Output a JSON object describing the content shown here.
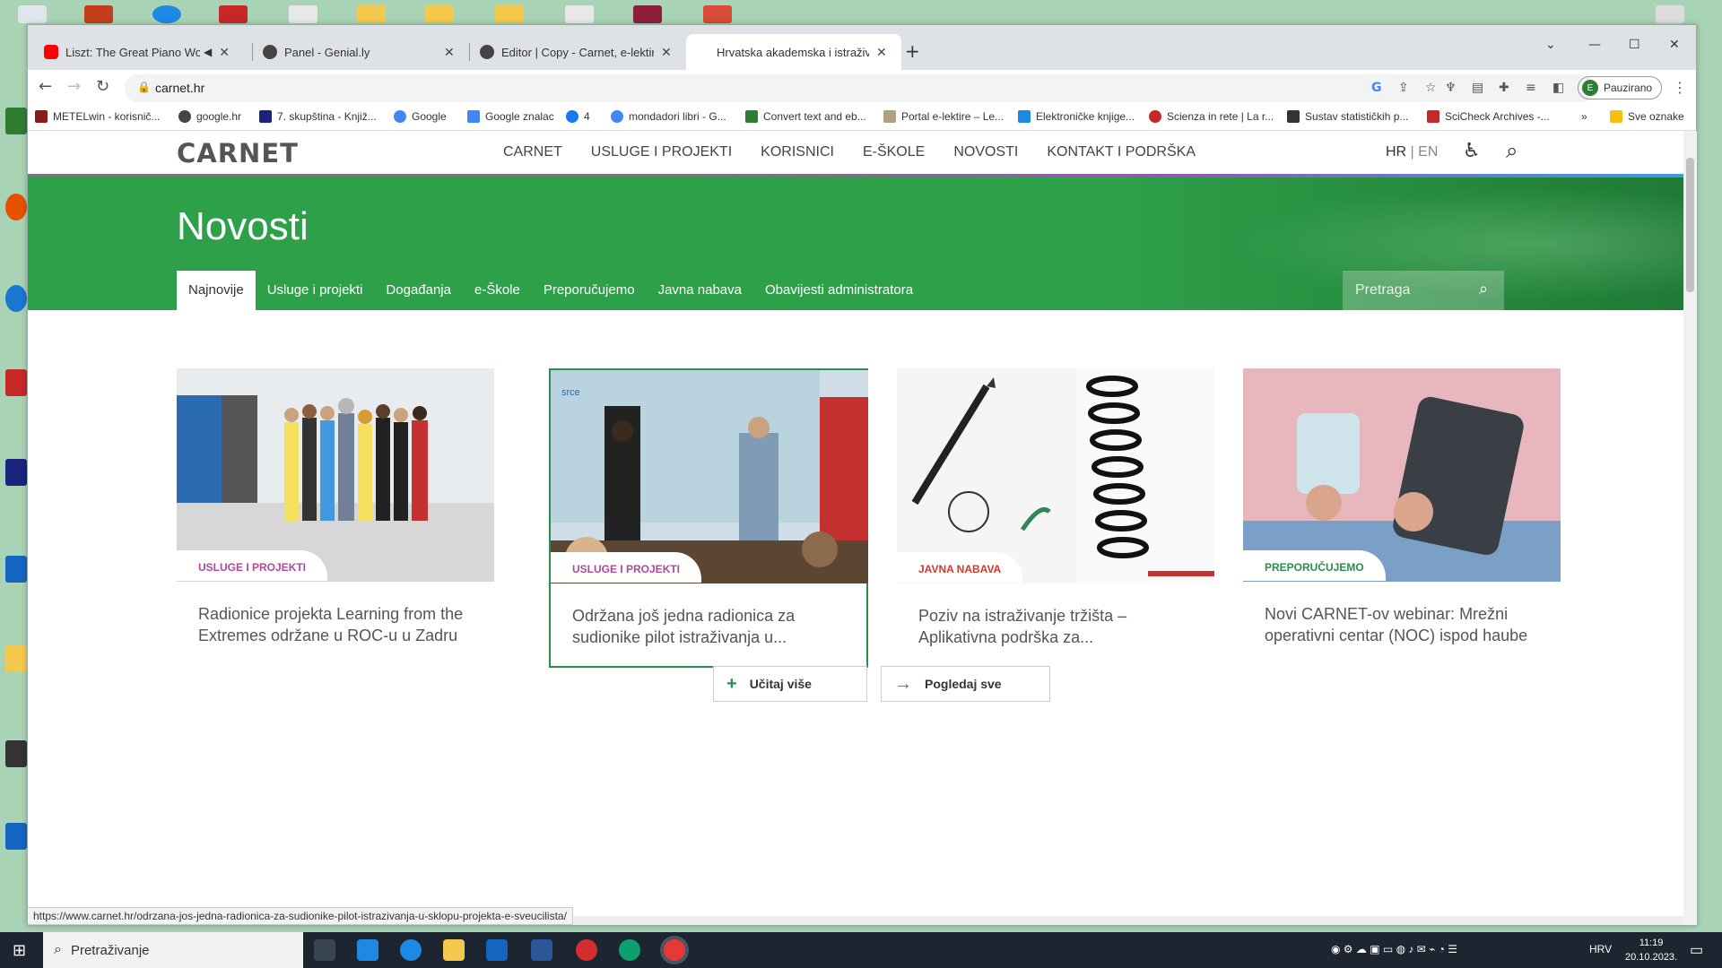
{
  "browser": {
    "tabs": [
      {
        "title": "Liszt: The Great Piano Works",
        "color": "#ff0000",
        "active": false
      },
      {
        "title": "Panel - Genial.ly",
        "color": "#333333",
        "active": false
      },
      {
        "title": "Editor | Copy - Carnet, e-lektira",
        "color": "#333333",
        "active": false
      },
      {
        "title": "Hrvatska akademska i istraživačka",
        "color": "#ffffff",
        "active": true
      }
    ],
    "url": "carnet.hr",
    "profile_label": "Pauzirano",
    "profile_initial": "E",
    "bookmarks": [
      {
        "label": "METELwin - korisnič...",
        "color": "#8b1a1a"
      },
      {
        "label": "google.hr",
        "color": "#444444"
      },
      {
        "label": "7. skupština - Knjiž...",
        "color": "#1a237e"
      },
      {
        "label": "Google",
        "color": "#4285f4"
      },
      {
        "label": "Google znalac",
        "color": "#4285f4"
      },
      {
        "label": "4",
        "color": "#1877f2"
      },
      {
        "label": "mondadori libri - G...",
        "color": "#4285f4"
      },
      {
        "label": "Convert text and eb...",
        "color": "#2e7d32"
      },
      {
        "label": "Portal e-lektire – Le...",
        "color": "#b0a080"
      },
      {
        "label": "Elektroničke knjige...",
        "color": "#1e88e5"
      },
      {
        "label": "Scienza in rete | La r...",
        "color": "#c62828"
      },
      {
        "label": "Sustav statističkih p...",
        "color": "#333333"
      },
      {
        "label": "SciCheck Archives -...",
        "color": "#c62828"
      },
      {
        "label": "Sve oznake",
        "color": "#f4c20d"
      }
    ],
    "status_url": "https://www.carnet.hr/odrzana-jos-jedna-radionica-za-sudionike-pilot-istrazivanja-u-sklopu-projekta-e-sveucilista/"
  },
  "site": {
    "logo": "CARNET",
    "nav": [
      "CARNET",
      "USLUGE I PROJEKTI",
      "KORISNICI",
      "E-ŠKOLE",
      "NOVOSTI",
      "KONTAKT I PODRŠKA"
    ],
    "lang_hr": "HR",
    "lang_sep": " | ",
    "lang_en": "EN",
    "hero_title": "Novosti",
    "subnav": [
      "Najnovije",
      "Usluge i projekti",
      "Događanja",
      "e-Škole",
      "Preporučujemo",
      "Javna nabava",
      "Obavijesti administratora"
    ],
    "search_placeholder": "Pretraga",
    "accent": "#2fa04a",
    "cards": [
      {
        "category": "USLUGE I PROJEKTI",
        "category_color": "#b0479b",
        "title": "Radionice projekta Learning from the Extremes održane u ROC-u u Zadru"
      },
      {
        "category": "USLUGE I PROJEKTI",
        "category_color": "#b0479b",
        "title": "Održana još jedna radionica za sudionike pilot istraživanja u..."
      },
      {
        "category": "JAVNA NABAVA",
        "category_color": "#d0392b",
        "title": "Poziv na istraživanje tržišta – Aplikativna podrška za..."
      },
      {
        "category": "PREPORUČUJEMO",
        "category_color": "#2a8f4a",
        "title": "Novi CARNET-ov webinar: Mrežni operativni centar (NOC) ispod haube"
      }
    ],
    "load_more": "Učitaj više",
    "view_all": "Pogledaj sve"
  },
  "taskbar": {
    "search_placeholder": "Pretraživanje",
    "lang": "HRV",
    "time": "11:19",
    "date": "20.10.2023."
  }
}
